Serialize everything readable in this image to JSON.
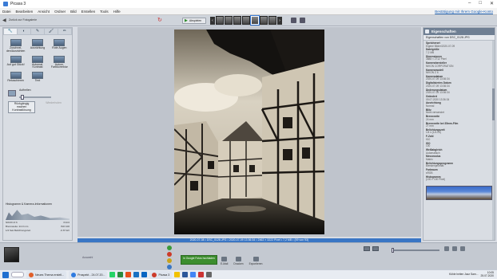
{
  "window": {
    "title": "Picasa 3",
    "controls": [
      "–",
      "□",
      "✕"
    ]
  },
  "menu": {
    "items": [
      "Datei",
      "Bearbeiten",
      "Ansicht",
      "Ordner",
      "Bild",
      "Erstellen",
      "Tools",
      "Hilfe"
    ],
    "login": "Bestätigung mit Ihrem Google-Konto"
  },
  "toolbar": {
    "back_label": "Zurück zur Fotogalerie",
    "play_label": "Abspielen"
  },
  "left_panel": {
    "tabs": [
      "🔧",
      "◐",
      "✎",
      "🖌",
      "✏"
    ],
    "tools": [
      {
        "label": "Zuschnei- den/Ausrichten"
      },
      {
        "label": "Ausrichtung"
      },
      {
        "label": "Rote Augen"
      },
      {
        "label": "Auf gut Glück!"
      },
      {
        "label": "Automat. Kontrast"
      },
      {
        "label": "Autom. Farbkorrektur"
      },
      {
        "label": "Retuschieren"
      },
      {
        "label": "Text"
      },
      {
        "label": ""
      }
    ],
    "fill_light_label": "Aufhellen",
    "fill_light_value": 0.05,
    "btn_undo": "Rückgängig machen Kontrastlösung",
    "btn_redo": "Wiederholen"
  },
  "histogram": {
    "title": "Histogramm & Kamera-Informationen",
    "cam": "NIKON Z 6",
    "f": "f/10.0",
    "focal": "Brennweite: 24.0 mm",
    "iso": "ISO 100",
    "exp": "1/4 Sek Belichtungszeit",
    "bias": "-0.67 EV"
  },
  "status": {
    "text": "2020-07-08 • DSC_0128.JPG  •  2020-07-09 13:36:34  •  2462 × 3222 Pixel  •  7,2 MB  •  (59 von 93)"
  },
  "right_panel": {
    "title": "Eigenschaften",
    "subtitle": "Eigenschaften von DSC_0128.JPG",
    "props": [
      {
        "k": "Speicherort",
        "v": "Eigene Bilder\\2020-07-09"
      },
      {
        "k": "Dateigröße",
        "v": "7,2 MB"
      },
      {
        "k": "Dimensionen",
        "v": "3888 × 2712 Pixel"
      },
      {
        "k": "Kamerahersteller",
        "v": "NIKON CORPORATION"
      },
      {
        "k": "Kameramodell",
        "v": "NIKON Z 6"
      },
      {
        "k": "Kameradatum",
        "v": "2020-07-09 13:36:34"
      },
      {
        "k": "Digitalisiertes Datum",
        "v": "2020-07-09 13:36:34"
      },
      {
        "k": "Änderungsdatum",
        "v": "2020-07-09 13:36:34"
      },
      {
        "k": "Geändert",
        "v": "09.07.2020 13:36:34"
      },
      {
        "k": "Ausrichtung",
        "v": "Normal"
      },
      {
        "k": "Blitz",
        "v": "Nicht verwendet"
      },
      {
        "k": "Brennweite",
        "v": "24 mm"
      },
      {
        "k": "Brennweite bei 35mm-Film",
        "v": "27 mm"
      },
      {
        "k": "Belichtungszeit",
        "v": "1/4 s (1/4.0S)"
      },
      {
        "k": "F-Zahl",
        "v": "f/10"
      },
      {
        "k": "ISO",
        "v": "100"
      },
      {
        "k": "Weißabgleich",
        "v": "Automatisch"
      },
      {
        "k": "Messmodus",
        "v": "Matrix"
      },
      {
        "k": "Belichtungsprogramm",
        "v": "Blendenpriorität"
      },
      {
        "k": "Farbraum",
        "v": "sRGB"
      },
      {
        "k": "Histogramm",
        "v": "(100 × 100 Pixel)"
      }
    ]
  },
  "bottom": {
    "tray_label": "Auswahl",
    "google_btn": "In Google Fotos hochladen",
    "actions": [
      "E-Mail",
      "Drucken",
      "Exportieren"
    ]
  },
  "taskbar": {
    "apps": [
      {
        "label": "Neues Thema erstell...",
        "color": "#e0602a"
      },
      {
        "label": "Prospekt - 24.07.20...",
        "color": "#2e7be0"
      },
      {
        "label": "Picasa 3",
        "color": "#cc3b2a"
      }
    ],
    "pinned_colors": [
      "#25d366",
      "#2b8a3e",
      "#e94e1b",
      "#1971c2",
      "#0a66c2",
      "#f2c200",
      "#2b579a",
      "#4285f4",
      "#c33",
      "#666"
    ],
    "tray_text": "Kühle heiten Jazz Sam...",
    "time": "10:05",
    "date": "25.07.2020"
  }
}
